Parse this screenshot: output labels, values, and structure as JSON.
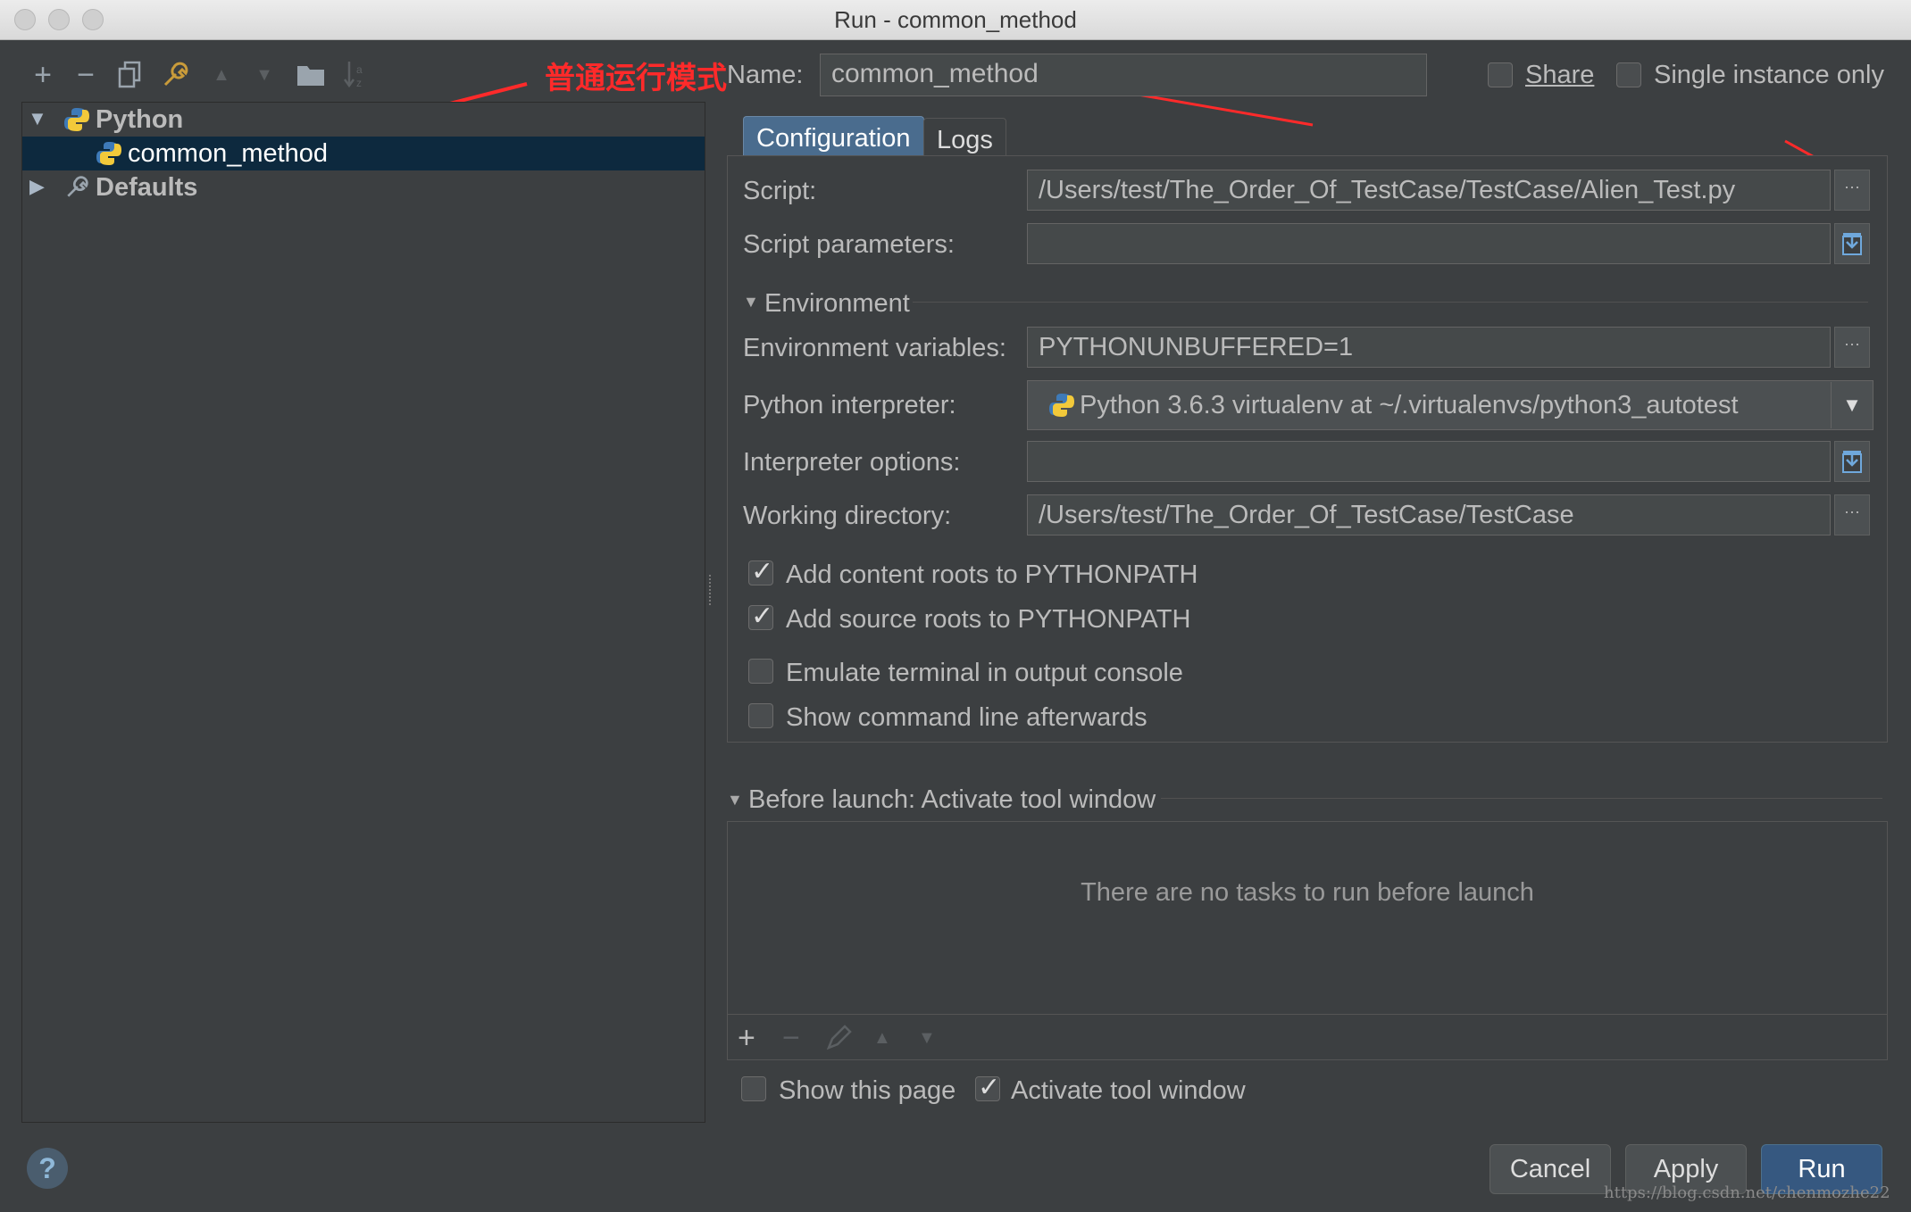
{
  "window": {
    "title": "Run - common_method"
  },
  "annotation": {
    "text": "普通运行模式"
  },
  "toolbar": {
    "add": "+",
    "remove": "−",
    "copy_icon": "copy-icon",
    "wrench_icon": "wrench-icon",
    "up": "▲",
    "down": "▼",
    "folder_icon": "folder-icon",
    "sort_icon": "sort-icon"
  },
  "tree": {
    "items": [
      {
        "label": "Python"
      },
      {
        "label": "common_method"
      },
      {
        "label": "Defaults"
      }
    ]
  },
  "header": {
    "name_label": "Name:",
    "name_value": "common_method",
    "share_label": "Share",
    "single_instance_label": "Single instance only"
  },
  "tabs": [
    {
      "label": "Configuration"
    },
    {
      "label": "Logs"
    }
  ],
  "config": {
    "script_label": "Script:",
    "script_value": "/Users/test/The_Order_Of_TestCase/TestCase/Alien_Test.py",
    "script_params_label": "Script parameters:",
    "script_params_value": "",
    "environment_label": "Environment",
    "env_vars_label": "Environment variables:",
    "env_vars_value": "PYTHONUNBUFFERED=1",
    "interpreter_label": "Python interpreter:",
    "interpreter_value": "Python 3.6.3 virtualenv at ~/.virtualenvs/python3_autotest",
    "interp_options_label": "Interpreter options:",
    "interp_options_value": "",
    "working_dir_label": "Working directory:",
    "working_dir_value": "/Users/test/The_Order_Of_TestCase/TestCase",
    "browse_glyph": "···",
    "checkboxes": [
      {
        "label": "Add content roots to PYTHONPATH",
        "checked": true
      },
      {
        "label": "Add source roots to PYTHONPATH",
        "checked": true
      },
      {
        "label": "Emulate terminal in output console",
        "checked": false
      },
      {
        "label": "Show command line afterwards",
        "checked": false
      }
    ]
  },
  "before_launch": {
    "title": "Before launch: Activate tool window",
    "empty_text": "There are no tasks to run before launch",
    "show_page_label": "Show this page",
    "activate_tool_label": "Activate tool window"
  },
  "buttons": {
    "cancel": "Cancel",
    "apply": "Apply",
    "run": "Run"
  },
  "help": {
    "glyph": "?"
  },
  "watermark": {
    "text": "https://blog.csdn.net/chenmozhe22"
  },
  "colors": {
    "selection": "#0d293e",
    "primary_button": "#365880",
    "annotation": "#ff2a2a",
    "active_tab": "#4a6c8e"
  }
}
